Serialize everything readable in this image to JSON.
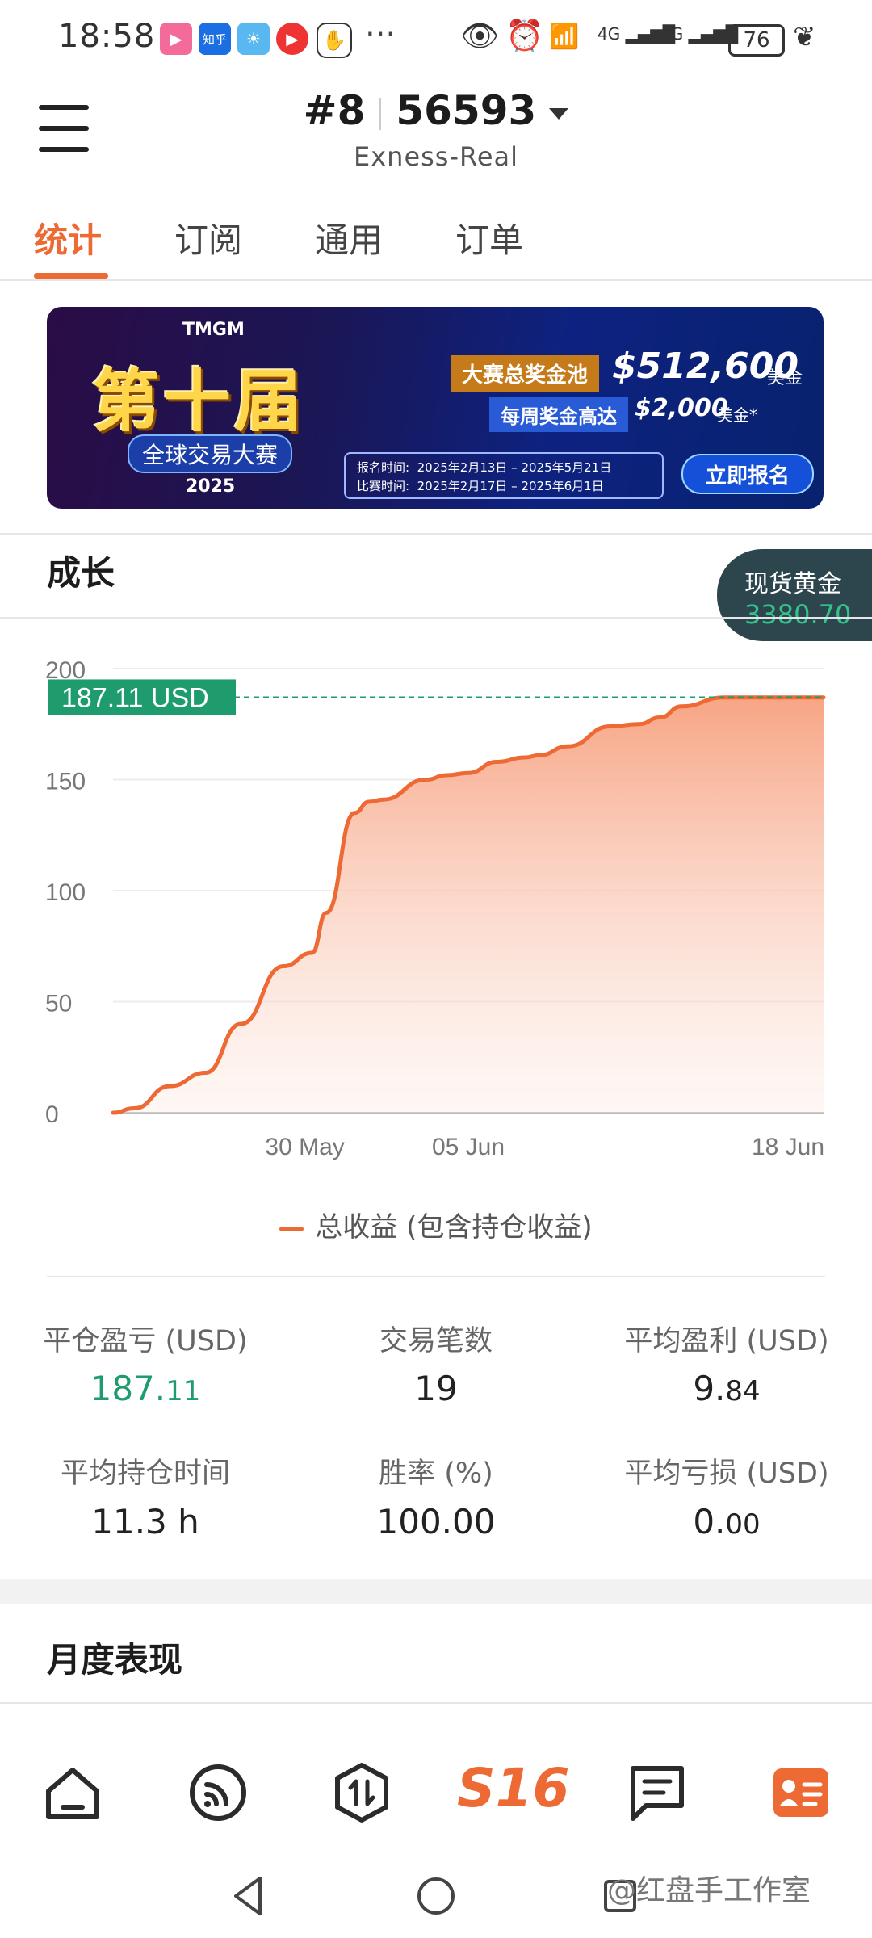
{
  "status_bar": {
    "time": "18:58",
    "app_icons": [
      "bilibili-icon",
      "zhihu-icon",
      "weather-icon",
      "music-icon",
      "hand-icon"
    ],
    "zhihu_label": "知乎",
    "more": "···",
    "battery": "76",
    "network": "4G"
  },
  "header": {
    "account_number": "#8",
    "account_id": "56593",
    "server": "Exness-Real"
  },
  "tabs": [
    {
      "label": "统计",
      "active": true
    },
    {
      "label": "订阅",
      "active": false
    },
    {
      "label": "通用",
      "active": false
    },
    {
      "label": "订单",
      "active": false
    }
  ],
  "banner": {
    "brand": "TMGM",
    "title": "第十届",
    "subtitle": "全球交易大赛",
    "year": "2025",
    "pool_label": "大赛总奖金池",
    "pool_amount": "$512,600",
    "pool_unit": "美金",
    "weekly_label": "每周奖金高达",
    "weekly_amount": "$2,000",
    "weekly_unit": "美金*",
    "reg_label": "报名时间:",
    "reg_dates": "2025年2月13日 – 2025年5月21日",
    "match_label": "比赛时间:",
    "match_dates": "2025年2月17日 – 2025年6月1日",
    "cta": "立即报名"
  },
  "growth": {
    "title": "成长",
    "ticker_label": "现货黄金",
    "ticker_value": "3380.70",
    "current_label": "187.11 USD",
    "legend": "总收益 (包含持仓收益)"
  },
  "chart_data": {
    "type": "area",
    "ylim": [
      0,
      200
    ],
    "yticks": [
      0,
      50,
      100,
      150,
      200
    ],
    "xtick_labels": [
      "30 May",
      "05 Jun",
      "18 Jun"
    ],
    "xtick_positions": [
      0.27,
      0.5,
      0.95
    ],
    "x": [
      0.0,
      0.03,
      0.08,
      0.13,
      0.18,
      0.24,
      0.28,
      0.3,
      0.34,
      0.36,
      0.38,
      0.44,
      0.47,
      0.5,
      0.54,
      0.58,
      0.6,
      0.64,
      0.7,
      0.74,
      0.77,
      0.8,
      0.86,
      0.9,
      0.95,
      1.0
    ],
    "series": [
      {
        "values": [
          0,
          2,
          12,
          18,
          40,
          66,
          72,
          90,
          135,
          140,
          141,
          150,
          152,
          153,
          158,
          160,
          161,
          165,
          174,
          175,
          178,
          183,
          187,
          187,
          187,
          187
        ]
      }
    ],
    "reference_value": 187.11,
    "color": "#ee6a35"
  },
  "stats": [
    {
      "label": "平仓盈亏 (USD)",
      "value_int": "187.",
      "value_dec": "11",
      "color": "green"
    },
    {
      "label": "交易笔数",
      "value_int": "19",
      "value_dec": "",
      "color": "default"
    },
    {
      "label": "平均盈利 (USD)",
      "value_int": "9.",
      "value_dec": "84",
      "color": "default"
    },
    {
      "label": "平均持仓时间",
      "value_int": "11.3 h",
      "value_dec": "",
      "color": "default"
    },
    {
      "label": "胜率 (%)",
      "value_int": "100.00",
      "value_dec": "",
      "color": "default"
    },
    {
      "label": "平均亏损 (USD)",
      "value_int": "0.",
      "value_dec": "00",
      "color": "default"
    }
  ],
  "monthly": {
    "title": "月度表现"
  },
  "bottom_nav": {
    "items": [
      "home-icon",
      "feed-icon",
      "trade-icon",
      "s16-logo",
      "messages-icon",
      "profile-icon"
    ],
    "s16_label": "S16"
  },
  "watermark": "@红盘手工作室",
  "colors": {
    "accent": "#ee6a35",
    "green": "#1f9c6e",
    "ticker_bg": "#2d454c"
  }
}
